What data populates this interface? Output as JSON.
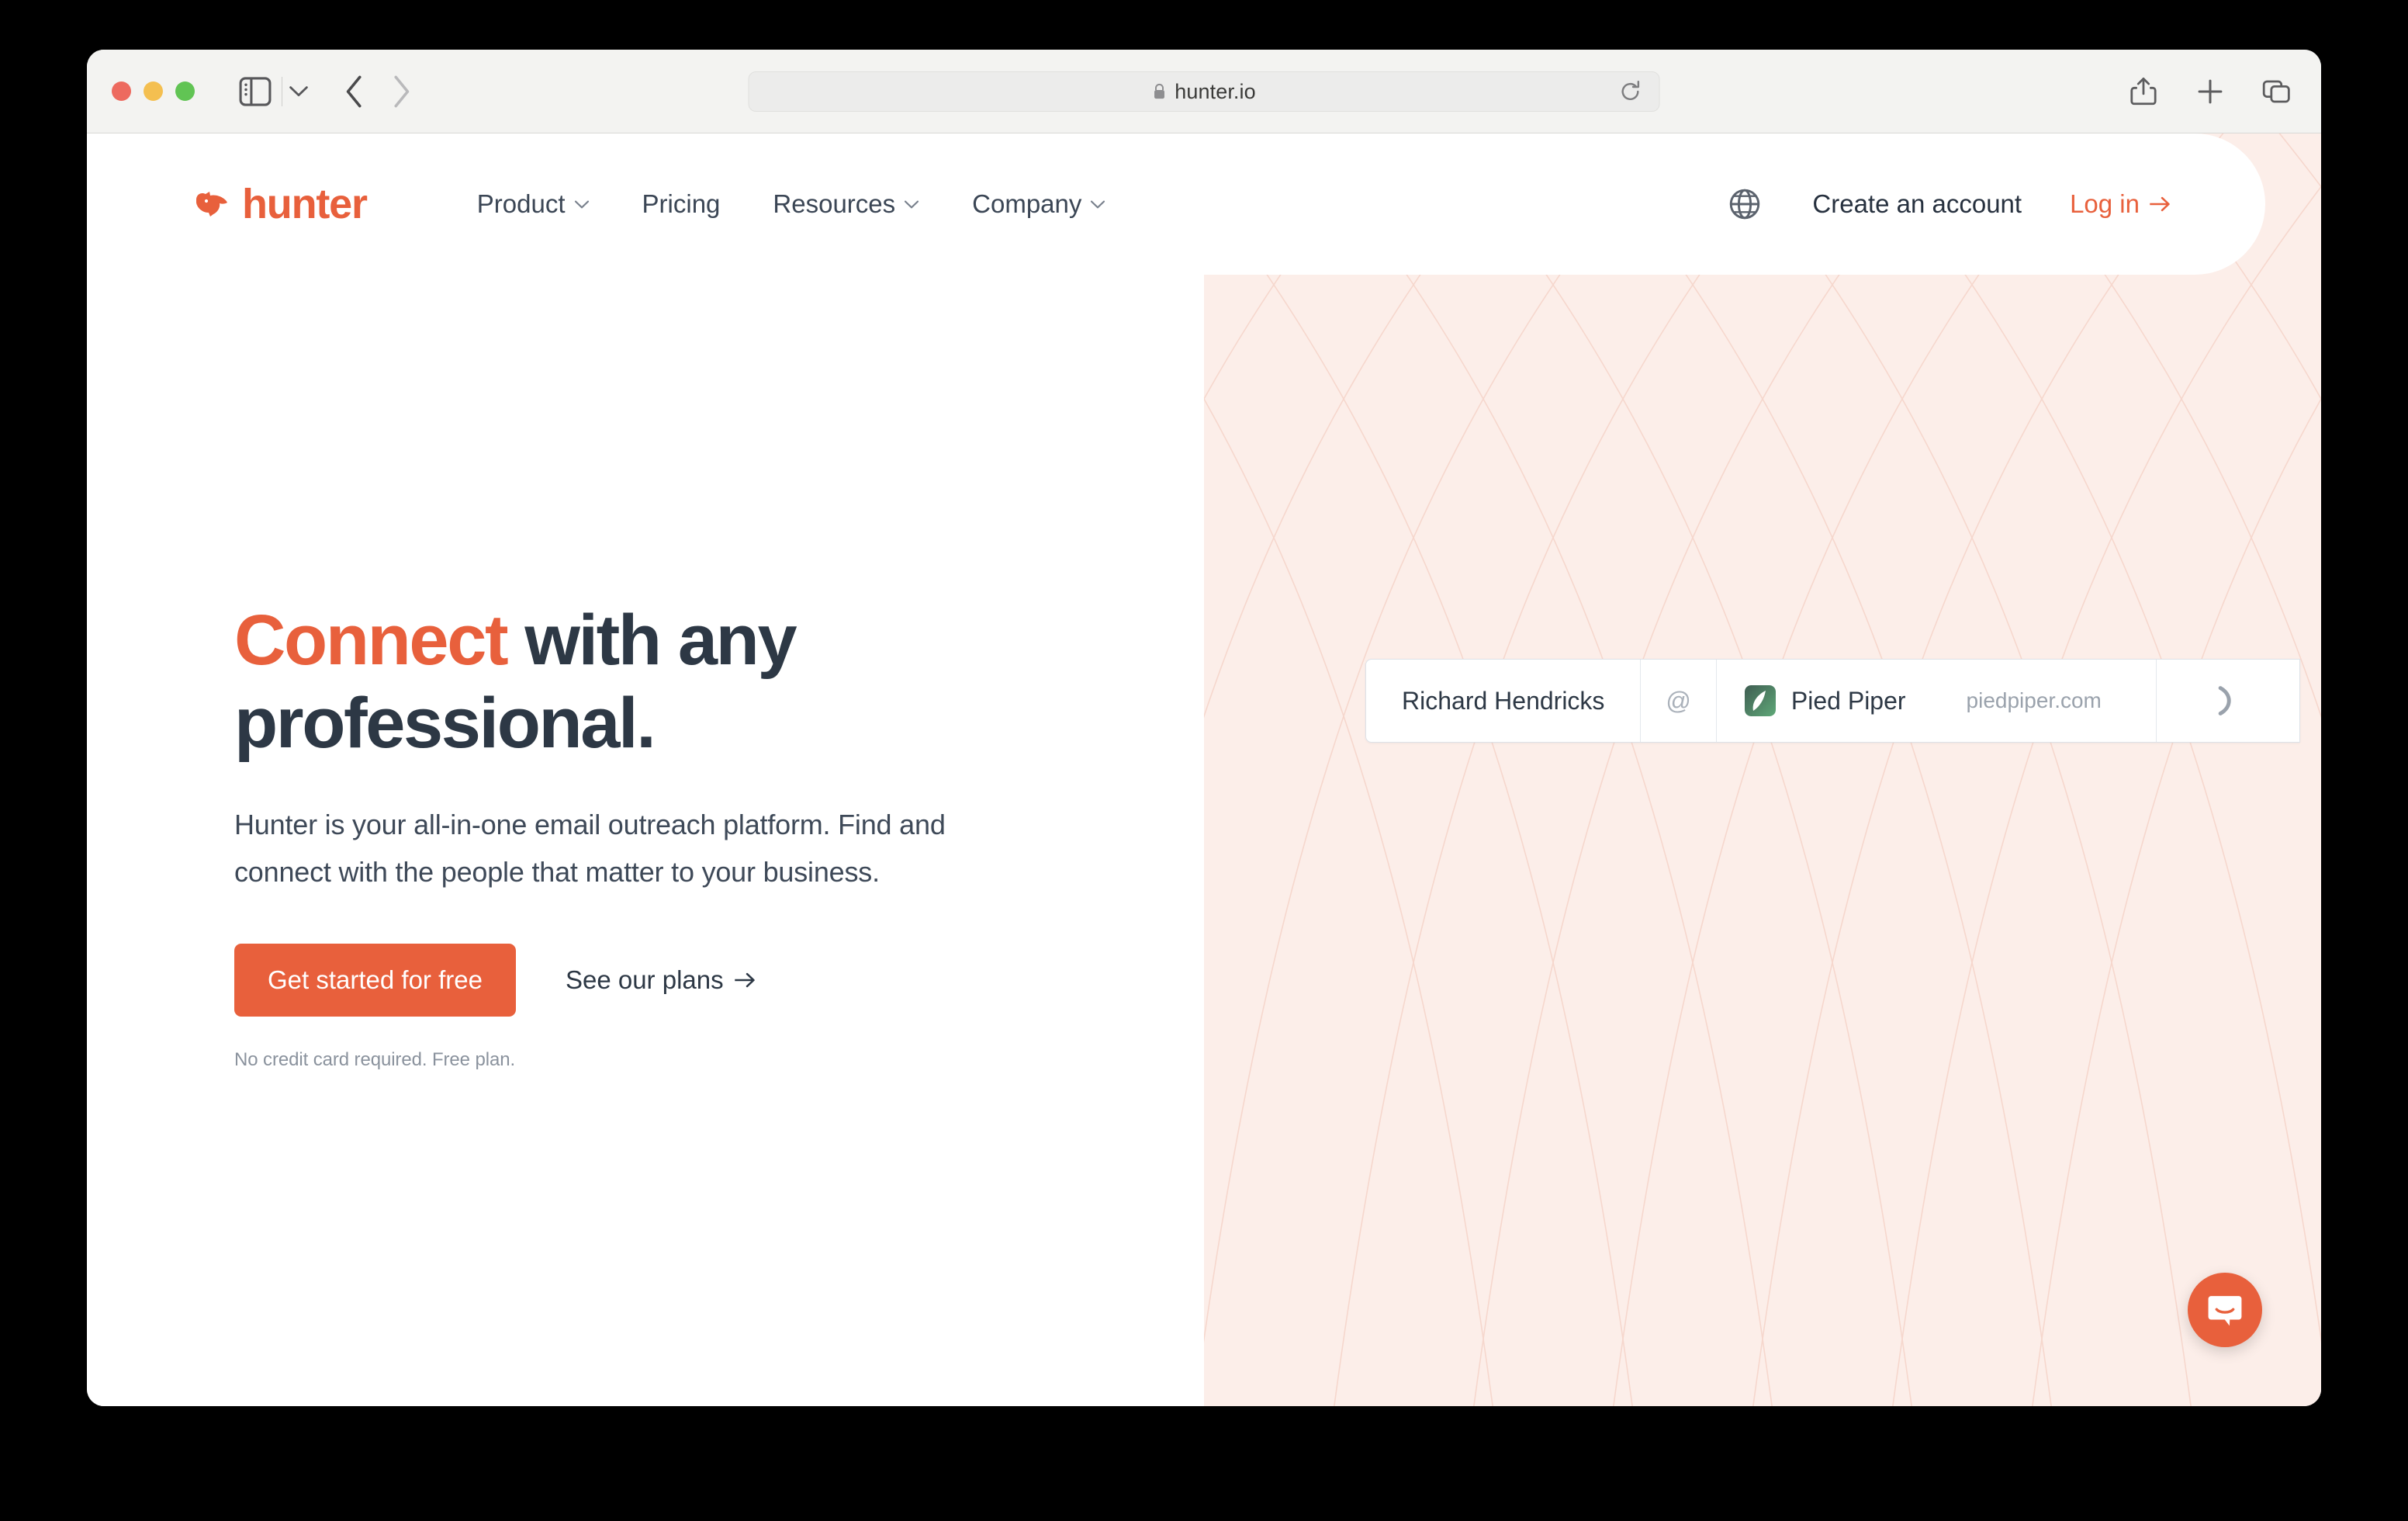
{
  "browser": {
    "url": "hunter.io",
    "lock_icon": "lock-icon",
    "reload_icon": "reload-icon",
    "sidebar_icon": "sidebar-toggle-icon",
    "sidebar_chevron_icon": "chevron-down-icon",
    "back_icon": "chevron-left-icon",
    "forward_icon": "chevron-right-icon",
    "share_icon": "share-icon",
    "new_tab_icon": "plus-icon",
    "tab_overview_icon": "tab-overview-icon",
    "traffic_lights": {
      "close_color": "#ed6a5f",
      "minimize_color": "#f4bf50",
      "maximize_color": "#61c454"
    }
  },
  "site": {
    "logo": {
      "text": "hunter",
      "mark_icon": "hunter-fox-logo-icon",
      "color": "#e8603c"
    },
    "nav_links": [
      {
        "label": "Product",
        "has_dropdown": true
      },
      {
        "label": "Pricing",
        "has_dropdown": false
      },
      {
        "label": "Resources",
        "has_dropdown": true
      },
      {
        "label": "Company",
        "has_dropdown": true
      }
    ],
    "nav_right": {
      "language_icon": "globe-icon",
      "create_account": "Create an account",
      "login": "Log in",
      "login_arrow_icon": "arrow-right-icon"
    }
  },
  "hero": {
    "headline_accent": "Connect",
    "headline_rest": " with any professional.",
    "subtext": "Hunter is your all-in-one email outreach platform. Find and connect with the people that matter to your business.",
    "cta_primary": "Get started for free",
    "cta_secondary": "See our plans",
    "cta_secondary_arrow_icon": "arrow-right-icon",
    "note": "No credit card required. Free plan.",
    "accent_color": "#e8603c",
    "heading_color": "#2d3845",
    "panel_bg_color": "#fceee9"
  },
  "search_widget": {
    "person_name": "Richard Hendricks",
    "at_symbol": "@",
    "company_name": "Pied Piper",
    "company_logo_icon": "pied-piper-leaf-icon",
    "domain": "piedpiper.com",
    "spinner_icon": "loading-spinner-icon"
  },
  "intercom": {
    "icon": "intercom-messenger-icon",
    "color": "#e8603c"
  }
}
